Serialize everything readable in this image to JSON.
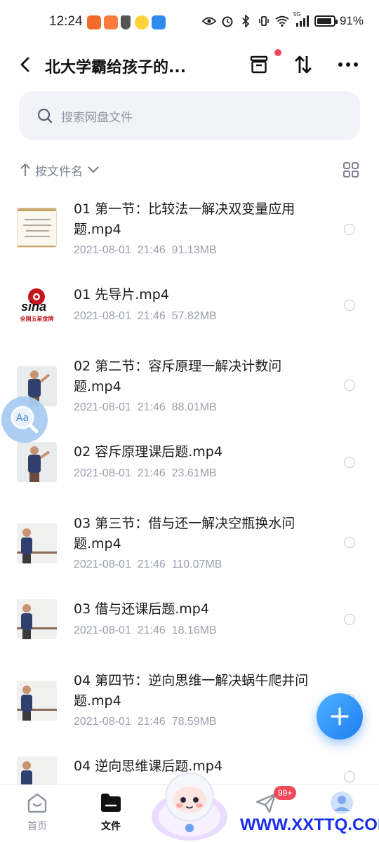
{
  "status_bar": {
    "time": "12:24",
    "battery_text": "91%",
    "battery_level": 0.91,
    "network_label": "5G"
  },
  "header": {
    "title": "北大学霸给孩子的..."
  },
  "search": {
    "placeholder": "搜索网盘文件"
  },
  "sort": {
    "label": "按文件名"
  },
  "files": [
    {
      "name": "01 第一节：比较法一解决双变量应用题.mp4",
      "date": "2021-08-01  21:46",
      "size": "91.13MB",
      "thumb": "doc"
    },
    {
      "name": "01 先导片.mp4",
      "date": "2021-08-01  21:46",
      "size": "57.82MB",
      "thumb": "sina"
    },
    {
      "name": "02 第二节：容斥原理一解决计数问题.mp4",
      "date": "2021-08-01  21:46",
      "size": "88.01MB",
      "thumb": "teacher-writing"
    },
    {
      "name": "02 容斥原理课后题.mp4",
      "date": "2021-08-01  21:46",
      "size": "23.61MB",
      "thumb": "teacher-writing"
    },
    {
      "name": "03 第三节：借与还一解决空瓶换水问题.mp4",
      "date": "2021-08-01  21:46",
      "size": "110.07MB",
      "thumb": "teacher-standing"
    },
    {
      "name": "03 借与还课后题.mp4",
      "date": "2021-08-01  21:46",
      "size": "18.16MB",
      "thumb": "teacher-standing"
    },
    {
      "name": "04 第四节：逆向思维一解决蜗牛爬井问题.mp4",
      "date": "2021-08-01  21:46",
      "size": "78.59MB",
      "thumb": "teacher-standing"
    },
    {
      "name": "04 逆向思维课后题.mp4",
      "date": "",
      "size": "",
      "thumb": "teacher-standing"
    }
  ],
  "thumb_text": {
    "sina_logo": "sina",
    "sina_sub": "全国五星金牌"
  },
  "bottom_nav": {
    "home_label": "首页",
    "files_label": "文件",
    "messages_badge": "99+"
  },
  "watermark": "WWW.XXTTQ.COM",
  "colors": {
    "accent": "#1c7ef2",
    "badge": "#f04a5a",
    "watermark": "#1a2fe8"
  }
}
